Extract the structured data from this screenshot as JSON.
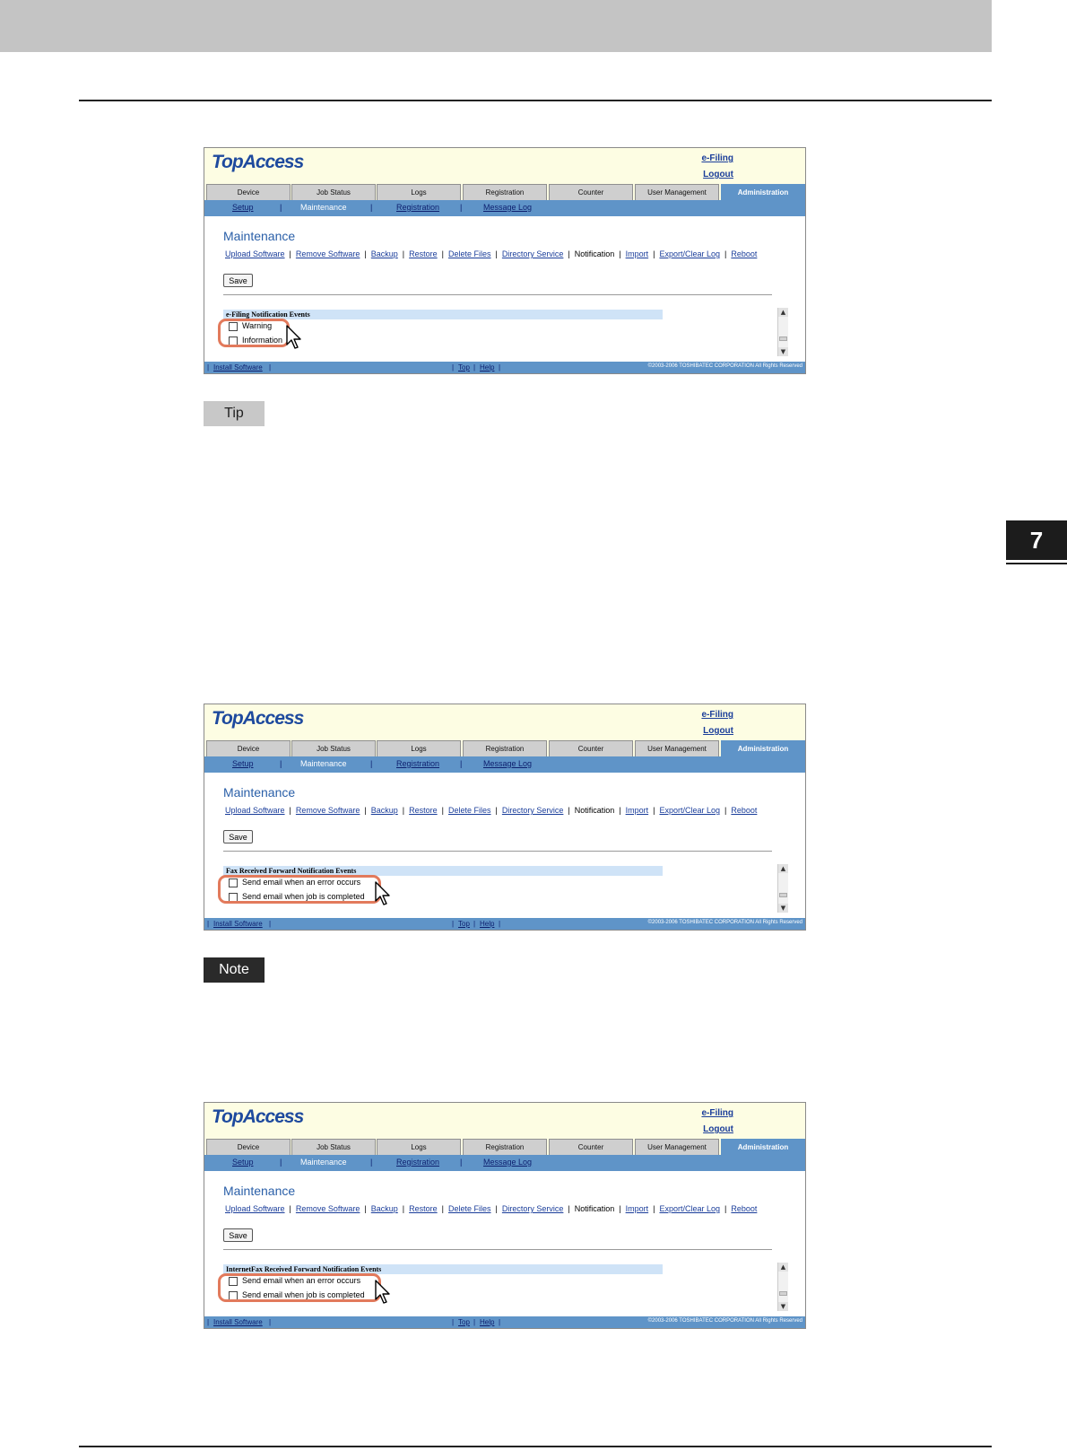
{
  "chapter": {
    "number": "7"
  },
  "callouts": {
    "tip": "Tip",
    "note": "Note"
  },
  "screens": [
    {
      "logo": "TopAccess",
      "header_links": {
        "efiling": "e-Filing",
        "logout": "Logout"
      },
      "tabs": [
        "Device",
        "Job Status",
        "Logs",
        "Registration",
        "Counter",
        "User Management",
        "Administration"
      ],
      "active_tab": "Administration",
      "subnav": {
        "setup": "Setup",
        "maintenance": "Maintenance",
        "registration": "Registration",
        "message_log": "Message Log",
        "sep": "|"
      },
      "title": "Maintenance",
      "links": [
        "Upload Software",
        "Remove Software",
        "Backup",
        "Restore",
        "Delete Files",
        "Directory Service",
        "Notification",
        "Import",
        "Export/Clear Log",
        "Reboot"
      ],
      "current_link": "Notification",
      "save": "Save",
      "section": "e-Filing Notification Events",
      "options": [
        "Warning",
        "Information"
      ],
      "footer": {
        "install": "Install Software",
        "top": "Top",
        "help": "Help",
        "pipe": "|",
        "copyright": "©2003-2006 TOSHIBATEC CORPORATION All Rights Reserved"
      }
    },
    {
      "logo": "TopAccess",
      "header_links": {
        "efiling": "e-Filing",
        "logout": "Logout"
      },
      "tabs": [
        "Device",
        "Job Status",
        "Logs",
        "Registration",
        "Counter",
        "User Management",
        "Administration"
      ],
      "active_tab": "Administration",
      "subnav": {
        "setup": "Setup",
        "maintenance": "Maintenance",
        "registration": "Registration",
        "message_log": "Message Log",
        "sep": "|"
      },
      "title": "Maintenance",
      "links": [
        "Upload Software",
        "Remove Software",
        "Backup",
        "Restore",
        "Delete Files",
        "Directory Service",
        "Notification",
        "Import",
        "Export/Clear Log",
        "Reboot"
      ],
      "current_link": "Notification",
      "save": "Save",
      "section": "Fax Received Forward Notification Events",
      "options": [
        "Send email when an error occurs",
        "Send email when job is completed"
      ],
      "footer": {
        "install": "Install Software",
        "top": "Top",
        "help": "Help",
        "pipe": "|",
        "copyright": "©2003-2006 TOSHIBATEC CORPORATION All Rights Reserved"
      }
    },
    {
      "logo": "TopAccess",
      "header_links": {
        "efiling": "e-Filing",
        "logout": "Logout"
      },
      "tabs": [
        "Device",
        "Job Status",
        "Logs",
        "Registration",
        "Counter",
        "User Management",
        "Administration"
      ],
      "active_tab": "Administration",
      "subnav": {
        "setup": "Setup",
        "maintenance": "Maintenance",
        "registration": "Registration",
        "message_log": "Message Log",
        "sep": "|"
      },
      "title": "Maintenance",
      "links": [
        "Upload Software",
        "Remove Software",
        "Backup",
        "Restore",
        "Delete Files",
        "Directory Service",
        "Notification",
        "Import",
        "Export/Clear Log",
        "Reboot"
      ],
      "current_link": "Notification",
      "save": "Save",
      "section": "InternetFax Received Forward Notification Events",
      "options": [
        "Send email when an error occurs",
        "Send email when job is completed"
      ],
      "footer": {
        "install": "Install Software",
        "top": "Top",
        "help": "Help",
        "pipe": "|",
        "copyright": "©2003-2006 TOSHIBATEC CORPORATION All Rights Reserved"
      }
    }
  ],
  "colors": {
    "highlight": "#e27a5c",
    "active_tab": "#5f94c8",
    "header_bg": "#fdfde3",
    "link": "#1a3d9a"
  }
}
